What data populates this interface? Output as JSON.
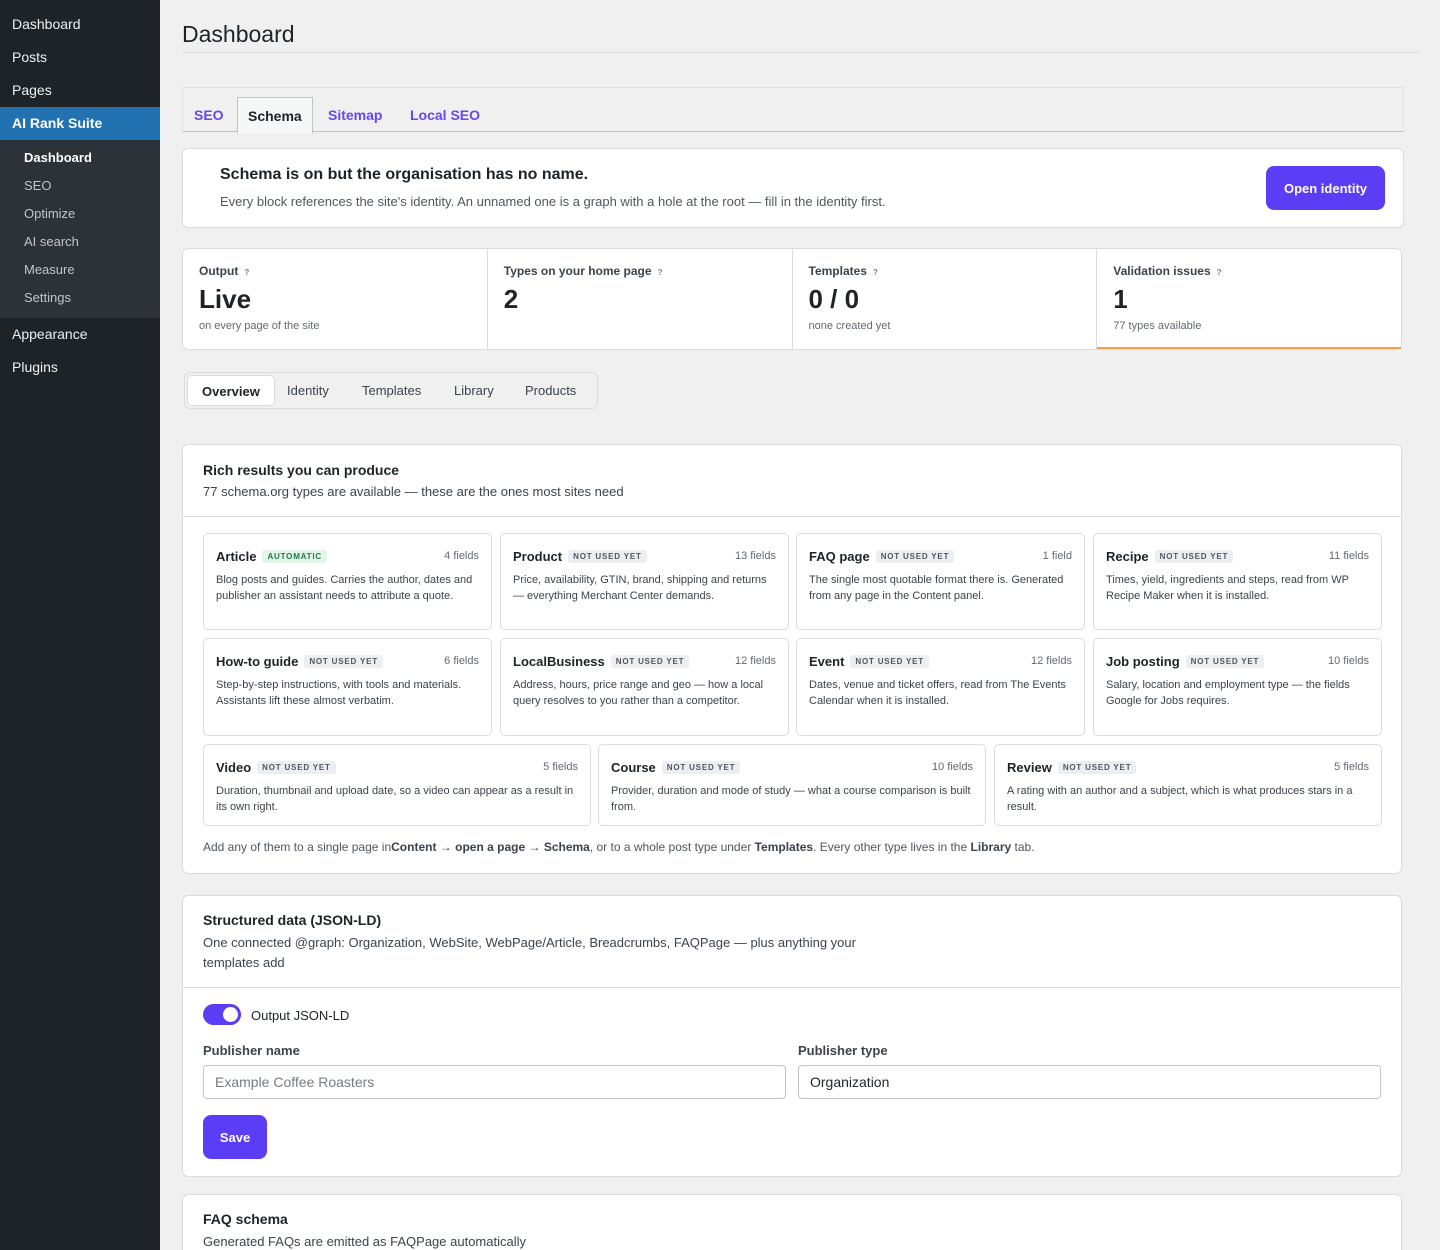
{
  "sidebar": {
    "top_items": [
      "Dashboard",
      "Posts",
      "Pages"
    ],
    "active_item": "AI Rank Suite",
    "sub_items": [
      "Dashboard",
      "SEO",
      "Optimize",
      "AI search",
      "Measure",
      "Settings"
    ],
    "bottom_items": [
      "Appearance",
      "Plugins"
    ]
  },
  "page": {
    "title": "Dashboard"
  },
  "top_tabs": [
    "SEO",
    "Schema",
    "Sitemap",
    "Local SEO"
  ],
  "notice": {
    "title": "Schema is on but the organisation has no name.",
    "text": "Every block references the site's identity. An unnamed one is a graph with a hole at the root — fill in the identity first.",
    "button": "Open identity"
  },
  "stats": [
    {
      "label": "Output",
      "help": "?",
      "value": "Live",
      "sub": "on every page of the site"
    },
    {
      "label": "Types on your home page",
      "help": "?",
      "value": "2",
      "sub": ""
    },
    {
      "label": "Templates",
      "help": "?",
      "value": "0 / 0",
      "sub": "none created yet"
    },
    {
      "label": "Validation issues",
      "help": "?",
      "value": "1",
      "sub": "77 types available"
    }
  ],
  "sub_tabs": [
    "Overview",
    "Identity",
    "Templates",
    "Library",
    "Products"
  ],
  "rich": {
    "title": "Rich results you can produce",
    "desc": "77 schema.org types are available — these are the ones most sites need",
    "tiles": [
      {
        "name": "Article",
        "badge": "AUTOMATIC",
        "fields": "4 fields",
        "desc": "Blog posts and guides. Carries the author, dates and publisher an assistant needs to attribute a quote."
      },
      {
        "name": "Product",
        "badge": "NOT USED YET",
        "fields": "13 fields",
        "desc": "Price, availability, GTIN, brand, shipping and returns — everything Merchant Center demands."
      },
      {
        "name": "FAQ page",
        "badge": "NOT USED YET",
        "fields": "1 field",
        "desc": "The single most quotable format there is. Generated from any page in the Content panel."
      },
      {
        "name": "Recipe",
        "badge": "NOT USED YET",
        "fields": "11 fields",
        "desc": "Times, yield, ingredients and steps, read from WP Recipe Maker when it is installed."
      },
      {
        "name": "How-to guide",
        "badge": "NOT USED YET",
        "fields": "6 fields",
        "desc": "Step-by-step instructions, with tools and materials. Assistants lift these almost verbatim."
      },
      {
        "name": "LocalBusiness",
        "badge": "NOT USED YET",
        "fields": "12 fields",
        "desc": "Address, hours, price range and geo — how a local query resolves to you rather than a competitor."
      },
      {
        "name": "Event",
        "badge": "NOT USED YET",
        "fields": "12 fields",
        "desc": "Dates, venue and ticket offers, read from The Events Calendar when it is installed."
      },
      {
        "name": "Job posting",
        "badge": "NOT USED YET",
        "fields": "10 fields",
        "desc": "Salary, location and employment type — the fields Google for Jobs requires."
      },
      {
        "name": "Video",
        "badge": "NOT USED YET",
        "fields": "5 fields",
        "desc": "Duration, thumbnail and upload date, so a video can appear as a result in its own right."
      },
      {
        "name": "Course",
        "badge": "NOT USED YET",
        "fields": "10 fields",
        "desc": "Provider, duration and mode of study — what a course comparison is built from."
      },
      {
        "name": "Review",
        "badge": "NOT USED YET",
        "fields": "5 fields",
        "desc": "A rating with an author and a subject, which is what produces stars in a result."
      }
    ],
    "foot": {
      "p1": "Add any of them to a single page in",
      "b1": "Content → open a page → Schema",
      "p2": ", or to a whole post type under ",
      "b2": "Templates",
      "p3": ". Every other type lives in the ",
      "b3": "Library",
      "p4": " tab."
    }
  },
  "json": {
    "title": "Structured data (JSON-LD)",
    "desc_line1": "One connected @graph: Organization, WebSite, WebPage/Article, Breadcrumbs, FAQPage — plus anything your",
    "desc_line2": "templates add",
    "toggle_label": "Output JSON-LD",
    "publisher_name_label": "Publisher name",
    "publisher_name_placeholder": "Example Coffee Roasters",
    "publisher_type_label": "Publisher type",
    "publisher_type_value": "Organization",
    "save": "Save"
  },
  "faq": {
    "title": "FAQ schema",
    "desc": "Generated FAQs are emitted as FAQPage automatically"
  },
  "colors": {
    "accent": "#5b3df5",
    "sidebar": "#1d2327",
    "sidebar_active": "#2271b1",
    "warning_bar": "#f0a050"
  }
}
